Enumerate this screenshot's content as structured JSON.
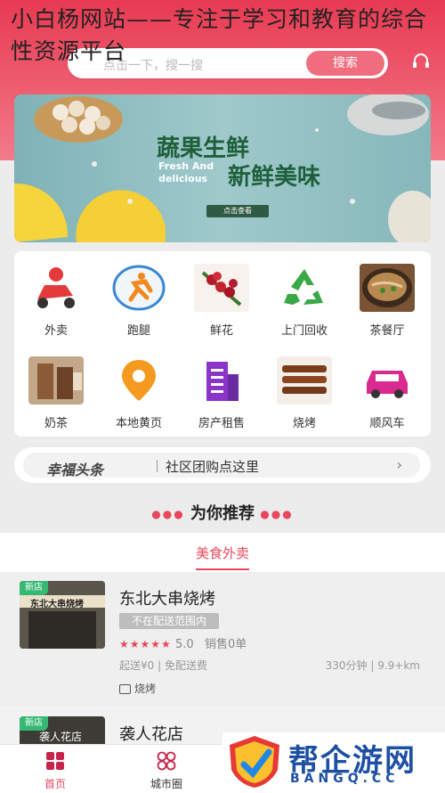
{
  "overlay_title": "小白杨网站——专注于学习和教育的综合性资源平台",
  "search": {
    "placeholder": "点击一下，搜一搜",
    "button": "搜索"
  },
  "banner": {
    "title_cn_1": "蔬果生鲜",
    "title_cn_2": "新鲜美味",
    "title_en": "Fresh And delicious",
    "cta": "点击查看"
  },
  "categories": [
    {
      "label": "外卖",
      "icon": "delivery-scooter-icon"
    },
    {
      "label": "跑腿",
      "icon": "running-man-icon"
    },
    {
      "label": "鲜花",
      "icon": "flowers-icon"
    },
    {
      "label": "上门回收",
      "icon": "recycle-icon"
    },
    {
      "label": "茶餐厅",
      "icon": "noodle-bowl-icon"
    },
    {
      "label": "奶茶",
      "icon": "milk-tea-icon"
    },
    {
      "label": "本地黄页",
      "icon": "location-pin-icon"
    },
    {
      "label": "房产租售",
      "icon": "building-icon"
    },
    {
      "label": "烧烤",
      "icon": "skewers-icon"
    },
    {
      "label": "顺风车",
      "icon": "car-icon"
    }
  ],
  "news": {
    "logo": "幸福头条",
    "text": "社区团购点这里"
  },
  "recommend": {
    "title": "为你推荐",
    "tab": "美食外卖"
  },
  "shops": [
    {
      "badge": "新店",
      "name": "东北大串烧烤",
      "tag": "不在配送范围内",
      "stars": "★★★★★",
      "rating": "5.0",
      "sales": "销售0单",
      "fees": "起送¥0 | 免配送费",
      "eta": "330分钟 | 9.9+km",
      "category": "烧烤",
      "sign": "东北大串烧烤"
    },
    {
      "badge": "新店",
      "name": "袭人花店",
      "sign": "袭人花店"
    }
  ],
  "bottom_nav": [
    {
      "label": "首页"
    },
    {
      "label": "城市圈"
    }
  ],
  "watermark": {
    "text": "帮企游网",
    "sub": "BANGQ.CC"
  },
  "colors": {
    "brand": "#e8465b",
    "search_button": "#f06d7e",
    "new_badge": "#35b872",
    "watermark": "#1d4fa3"
  }
}
